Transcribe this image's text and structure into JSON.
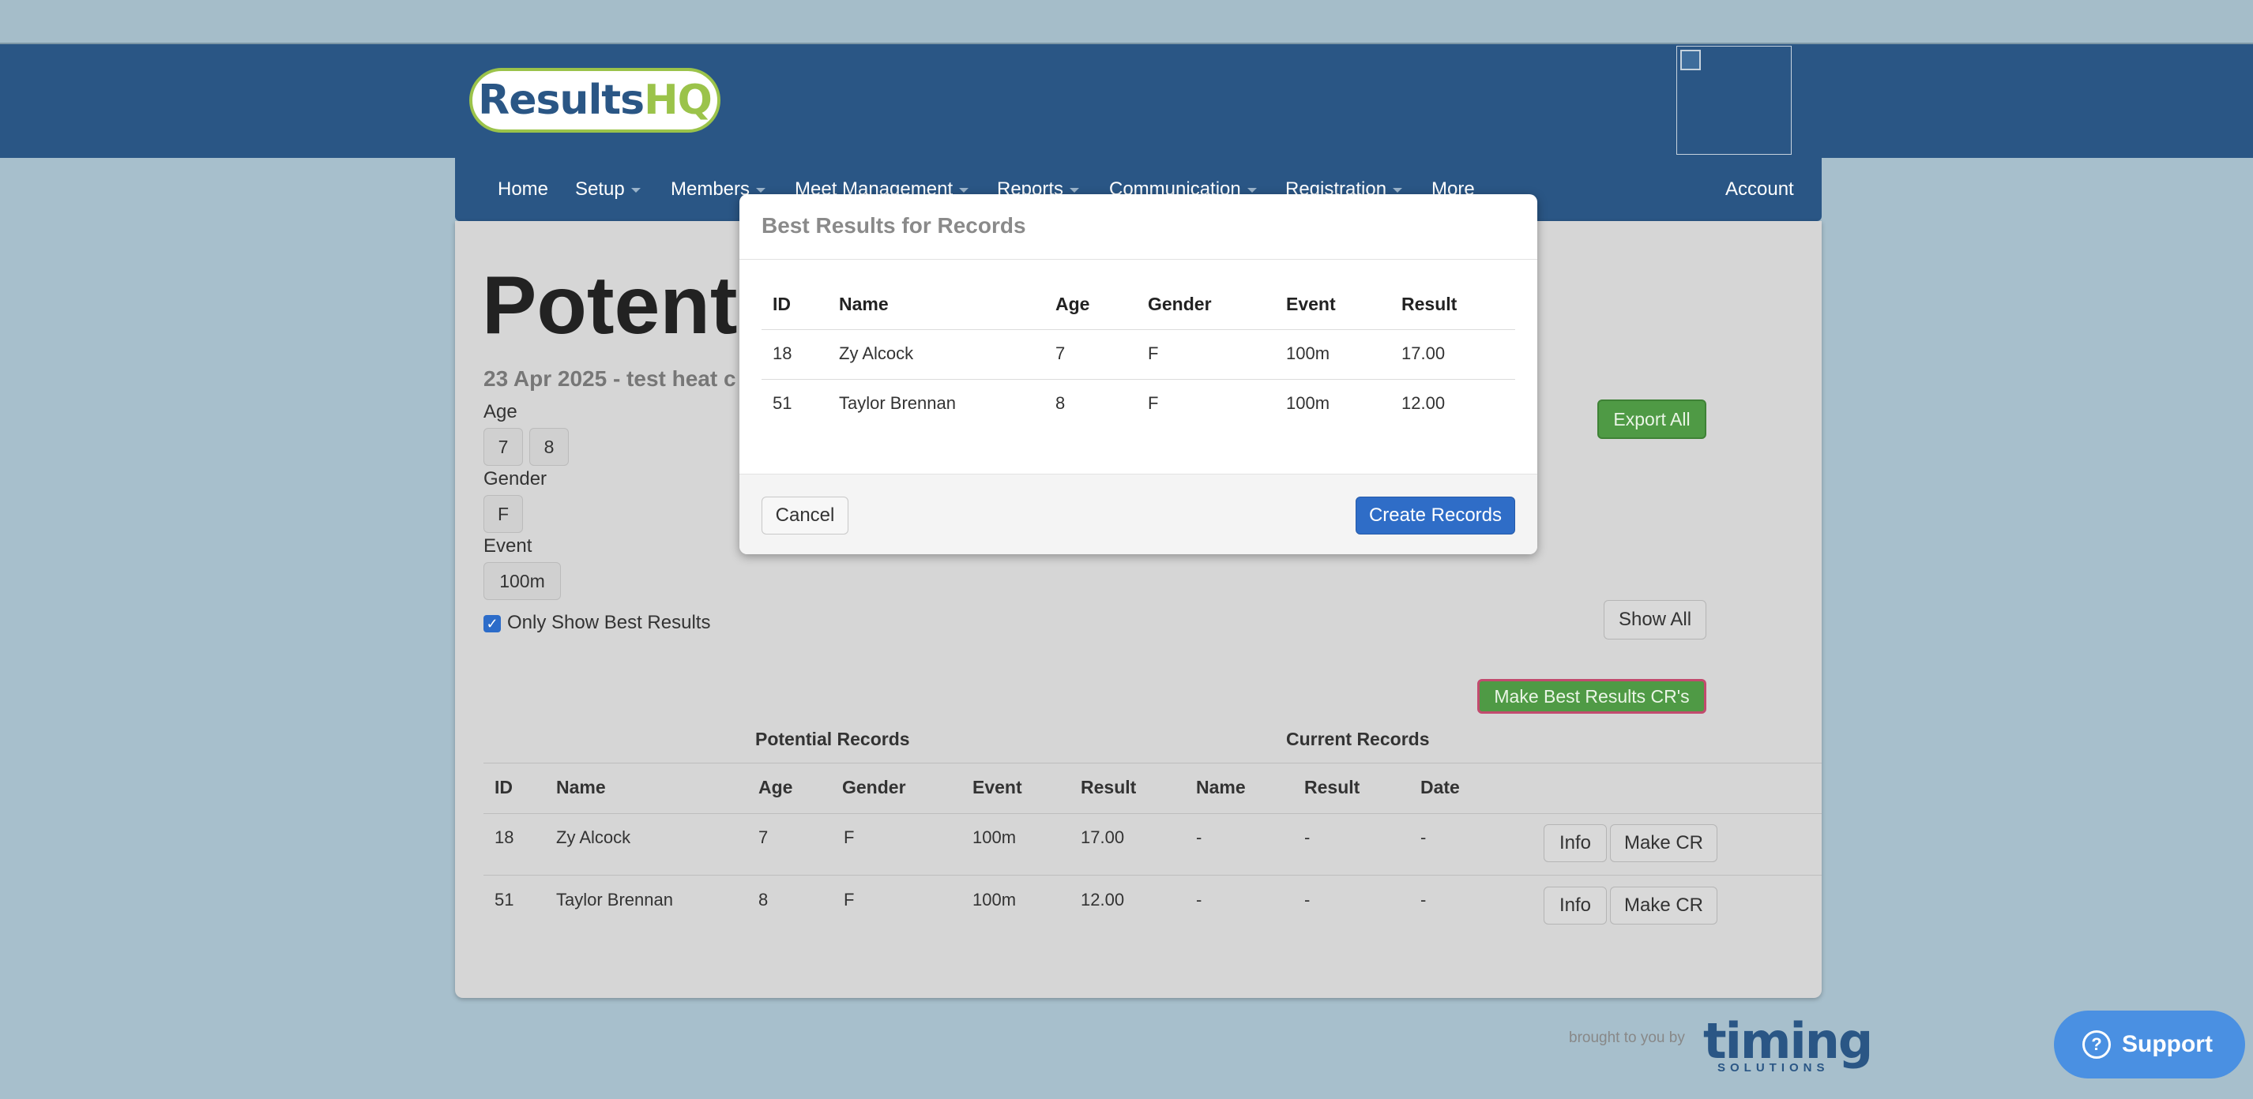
{
  "header": {
    "logo_part1": "Results",
    "logo_part2": "HQ"
  },
  "nav": {
    "items": [
      {
        "label": "Home"
      },
      {
        "label": "Setup"
      },
      {
        "label": "Members"
      },
      {
        "label": "Meet Management"
      },
      {
        "label": "Reports"
      },
      {
        "label": "Communication"
      },
      {
        "label": "Registration"
      },
      {
        "label": "More"
      }
    ],
    "account": "Account"
  },
  "page": {
    "title": "Potentia",
    "subtitle": "23 Apr 2025 - test heat c"
  },
  "filters": {
    "age_label": "Age",
    "ages": [
      "7",
      "8"
    ],
    "gender_label": "Gender",
    "genders": [
      "F"
    ],
    "event_label": "Event",
    "events": [
      "100m"
    ],
    "only_best_label": "Only Show Best Results",
    "only_best_checked": true
  },
  "actions": {
    "export_all": "Export All",
    "show_all": "Show All",
    "make_best": "Make Best Results CR's"
  },
  "table": {
    "group_potential": "Potential Records",
    "group_current": "Current Records",
    "columns": [
      "ID",
      "Name",
      "Age",
      "Gender",
      "Event",
      "Result",
      "Name",
      "Result",
      "Date"
    ],
    "rows": [
      {
        "id": "18",
        "name": "Zy Alcock",
        "age": "7",
        "gender": "F",
        "event": "100m",
        "result": "17.00",
        "cr_name": "-",
        "cr_result": "-",
        "cr_date": "-"
      },
      {
        "id": "51",
        "name": "Taylor Brennan",
        "age": "8",
        "gender": "F",
        "event": "100m",
        "result": "12.00",
        "cr_name": "-",
        "cr_result": "-",
        "cr_date": "-"
      }
    ],
    "info_label": "Info",
    "make_cr_label": "Make CR"
  },
  "modal": {
    "title": "Best Results for Records",
    "columns": [
      "ID",
      "Name",
      "Age",
      "Gender",
      "Event",
      "Result"
    ],
    "rows": [
      {
        "id": "18",
        "name": "Zy Alcock",
        "age": "7",
        "gender": "F",
        "event": "100m",
        "result": "17.00"
      },
      {
        "id": "51",
        "name": "Taylor Brennan",
        "age": "8",
        "gender": "F",
        "event": "100m",
        "result": "12.00"
      }
    ],
    "cancel": "Cancel",
    "create": "Create Records"
  },
  "footer": {
    "brought": "brought to you by",
    "timing": "timing",
    "solutions": "SOLUTIONS",
    "support": "Support"
  },
  "colors": {
    "brand_blue": "#2a5685",
    "brand_green": "#9bc34a",
    "button_green": "#4f9a45",
    "primary_blue": "#2f6dc7",
    "support_blue": "#4a90e2",
    "highlight_border": "#c24b6e"
  }
}
